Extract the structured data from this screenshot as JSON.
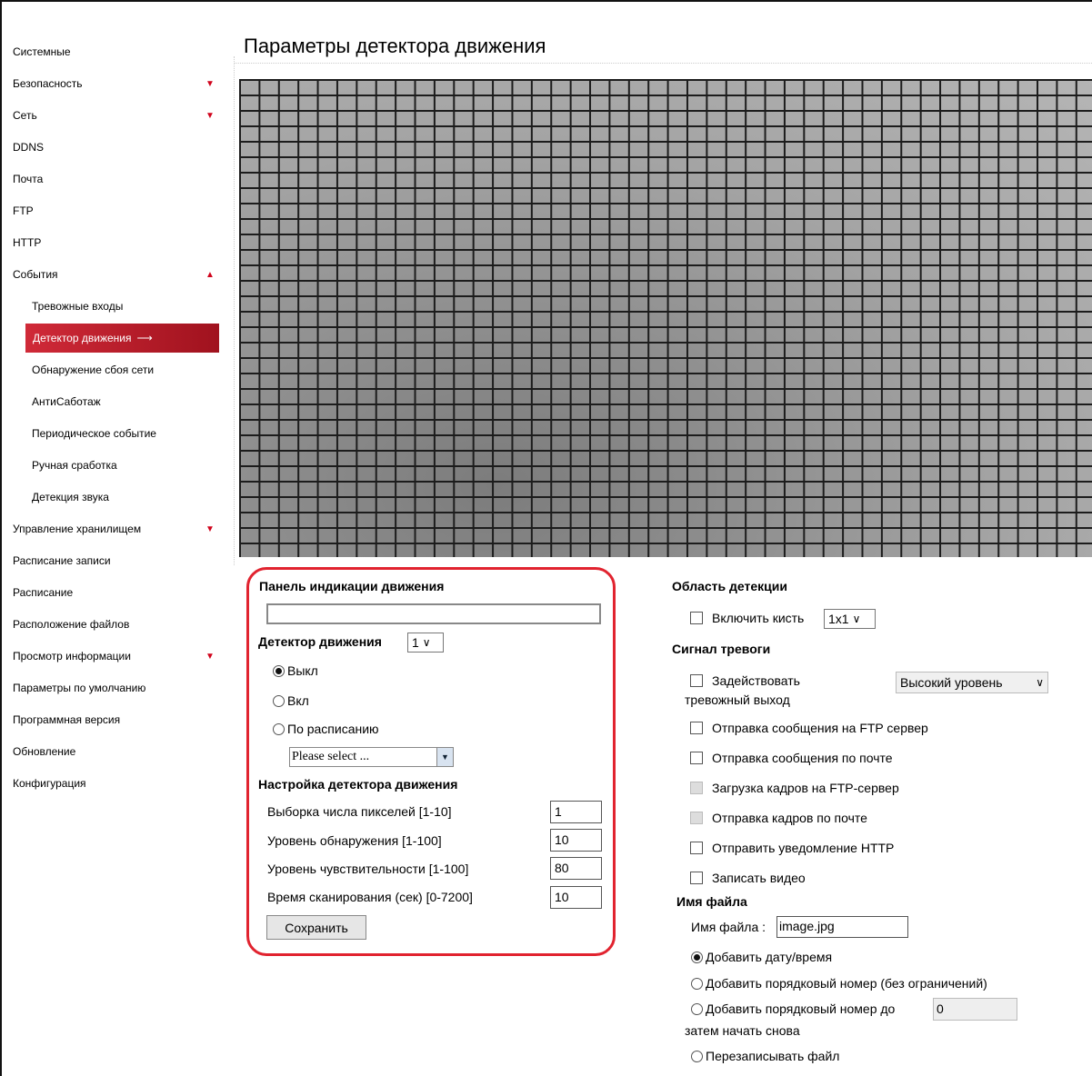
{
  "page_title": "Параметры детектора движения",
  "sidebar": {
    "items": [
      {
        "label": "Системные"
      },
      {
        "label": "Безопасность",
        "caret": "▼"
      },
      {
        "label": "Сеть",
        "caret": "▼"
      },
      {
        "label": "DDNS"
      },
      {
        "label": "Почта"
      },
      {
        "label": "FTP"
      },
      {
        "label": "HTTP"
      },
      {
        "label": "События",
        "caret": "▲"
      },
      {
        "label": "Тревожные входы"
      },
      {
        "label": "Детектор движения",
        "arrow": "⟶"
      },
      {
        "label": "Обнаружение сбоя сети"
      },
      {
        "label": "АнтиСаботаж"
      },
      {
        "label": "Периодическое событие"
      },
      {
        "label": "Ручная сработка"
      },
      {
        "label": "Детекция звука"
      },
      {
        "label": "Управление хранилищем",
        "caret": "▼"
      },
      {
        "label": "Расписание записи"
      },
      {
        "label": "Расписание"
      },
      {
        "label": "Расположение файлов"
      },
      {
        "label": "Просмотр информации",
        "caret": "▼"
      },
      {
        "label": "Параметры по умолчанию"
      },
      {
        "label": "Программная версия"
      },
      {
        "label": "Обновление"
      },
      {
        "label": "Конфигурация"
      }
    ]
  },
  "motion": {
    "indicator_title": "Панель индикации движения",
    "detector_label": "Детектор движения",
    "detector_value": "1",
    "modes": [
      "Выкл",
      "Вкл",
      "По расписанию"
    ],
    "selected_mode": "Выкл",
    "schedule_placeholder": "Please select ...",
    "settings_title": "Настройка детектора движения",
    "params": [
      {
        "label": "Выборка числа пикселей [1-10]",
        "value": "1"
      },
      {
        "label": "Уровень обнаружения [1-100]",
        "value": "10"
      },
      {
        "label": "Уровень чувствительности [1-100]",
        "value": "80"
      },
      {
        "label": "Время сканирования (сек) [0-7200]",
        "value": "10"
      }
    ],
    "save_label": "Сохранить"
  },
  "detection_area": {
    "title": "Область детекции",
    "brush_label": "Включить кисть",
    "brush_value": "1x1"
  },
  "alarm": {
    "title": "Сигнал тревоги",
    "output_label_1": "Задействовать",
    "output_label_2": "тревожный выход",
    "level_value": "Высокий уровень",
    "options": [
      {
        "label": "Отправка сообщения на FTP сервер",
        "disabled": false
      },
      {
        "label": "Отправка сообщения по почте",
        "disabled": false
      },
      {
        "label": "Загрузка кадров на FTP-сервер",
        "disabled": true
      },
      {
        "label": "Отправка кадров по почте",
        "disabled": true
      },
      {
        "label": "Отправить уведомление HTTP",
        "disabled": false
      },
      {
        "label": "Записать видео",
        "disabled": false
      }
    ]
  },
  "filename": {
    "title": "Имя файла",
    "label": "Имя файла :",
    "value": "image.jpg",
    "options": [
      "Добавить дату/время",
      "Добавить порядковый номер (без ограничений)",
      "Добавить порядковый номер до",
      "Перезаписывать файл"
    ],
    "restart_text": "затем начать снова",
    "limit_value": "0",
    "selected": "Добавить дату/время"
  }
}
